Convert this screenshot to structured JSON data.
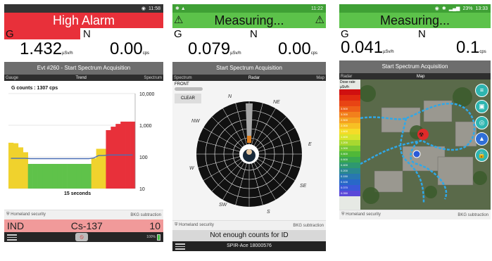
{
  "screen1": {
    "status_time": "11:58",
    "alarm_title": "High Alarm",
    "gamma_letter": "G",
    "neutron_letter": "N",
    "gamma_value": "1.432",
    "gamma_unit": "µSv/h",
    "neutron_value": "0.00",
    "neutron_unit": "cps",
    "event_text": "Evt #260 - Start Spectrum Acquisition",
    "tabs": [
      "Gauge",
      "Trend",
      "Spectrum"
    ],
    "chart_data": {
      "type": "bar",
      "annotation": "G counts : 1307 cps",
      "xlabel": "15 seconds",
      "y_ticks": [
        "10,000",
        "1,000",
        "100",
        "10"
      ],
      "yscale": "log",
      "ylim": [
        10,
        10000
      ],
      "bars": [
        {
          "value": 280,
          "color": "#f0d22d"
        },
        {
          "value": 270,
          "color": "#f0d22d"
        },
        {
          "value": 200,
          "color": "#f0d22d"
        },
        {
          "value": 140,
          "color": "#f0d22d"
        },
        {
          "value": 60,
          "color": "#5fc24a"
        },
        {
          "value": 60,
          "color": "#5fc24a"
        },
        {
          "value": 60,
          "color": "#5fc24a"
        },
        {
          "value": 60,
          "color": "#5fc24a"
        },
        {
          "value": 60,
          "color": "#5fc24a"
        },
        {
          "value": 60,
          "color": "#5fc24a"
        },
        {
          "value": 60,
          "color": "#5fc24a"
        },
        {
          "value": 60,
          "color": "#5fc24a"
        },
        {
          "value": 60,
          "color": "#5fc24a"
        },
        {
          "value": 60,
          "color": "#5fc24a"
        },
        {
          "value": 60,
          "color": "#5fc24a"
        },
        {
          "value": 60,
          "color": "#5fc24a"
        },
        {
          "value": 60,
          "color": "#5fc24a"
        },
        {
          "value": 90,
          "color": "#f0d22d"
        },
        {
          "value": 180,
          "color": "#f0d22d"
        },
        {
          "value": 180,
          "color": "#f0d22d"
        },
        {
          "value": 700,
          "color": "#e8303a"
        },
        {
          "value": 900,
          "color": "#e8303a"
        },
        {
          "value": 1100,
          "color": "#e8303a"
        },
        {
          "value": 1300,
          "color": "#e8303a"
        },
        {
          "value": 1300,
          "color": "#e8303a"
        },
        {
          "value": 1300,
          "color": "#e8303a"
        }
      ],
      "trend_line": [
        90,
        90,
        90,
        90,
        88,
        88,
        88,
        88,
        88,
        88,
        88,
        88,
        88,
        88,
        88,
        88,
        88,
        92,
        110,
        110,
        115,
        115,
        115,
        115,
        115,
        115
      ]
    },
    "footer_left": "Homeland security",
    "footer_right": "BKG subtraction",
    "ind_left": "IND",
    "ind_mid": "Cs-137",
    "ind_right": "10",
    "battery_pct": "100%"
  },
  "screen2": {
    "status_time": "11:22",
    "title": "Measuring...",
    "gamma_letter": "G",
    "neutron_letter": "N",
    "gamma_value": "0.079",
    "gamma_unit": "µSv/h",
    "neutron_value": "0.00",
    "neutron_unit": "cps",
    "event_text": "Start Spectrum Acquisition",
    "tabs": [
      "Spectrum",
      "Radar",
      "Map"
    ],
    "front_label": "FRONT",
    "clear_label": "CLEAR",
    "compass": [
      "N",
      "NE",
      "E",
      "SE",
      "S",
      "SW",
      "W",
      "NW"
    ],
    "footer_left": "Homeland security",
    "footer_right": "BKG subtraction",
    "id_message": "Not enough counts for ID",
    "device_name": "SPIR-Ace 18000576"
  },
  "screen3": {
    "status_time": "13:33",
    "status_batt": "23%",
    "title": "Measuring...",
    "gamma_letter": "G",
    "neutron_letter": "N",
    "gamma_value": "0.041",
    "gamma_unit": "µSv/h",
    "neutron_value": "0.1",
    "neutron_unit": "cps",
    "event_text": "Start Spectrum Acquisition",
    "tabs": [
      "Radar",
      "Map",
      ""
    ],
    "legend_title_1": "Dose rate",
    "legend_title_2": "µSv/h",
    "legend_colors": [
      "#d01010",
      "#e02a10",
      "#e84414",
      "#ee6018",
      "#f2801c",
      "#f5a020",
      "#f7c024",
      "#f5dc28",
      "#d8e42c",
      "#a8d830",
      "#78c834",
      "#50b838",
      "#3aa850",
      "#2e9870",
      "#2a8890",
      "#2878b0",
      "#2868c8",
      "#3a58d8",
      "#5a48d8"
    ],
    "legend_values": [
      "",
      "",
      "",
      "3.500",
      "3.000",
      "2.500",
      "2.000",
      "1.600",
      "1.400",
      "1.200",
      "1.000",
      "0.800",
      "0.600",
      "0.400",
      "0.200",
      "0.150",
      "0.100",
      "0.070",
      "0.050",
      "0.030"
    ],
    "footer_left": "Homeland security",
    "footer_right": "BKG subtraction"
  }
}
